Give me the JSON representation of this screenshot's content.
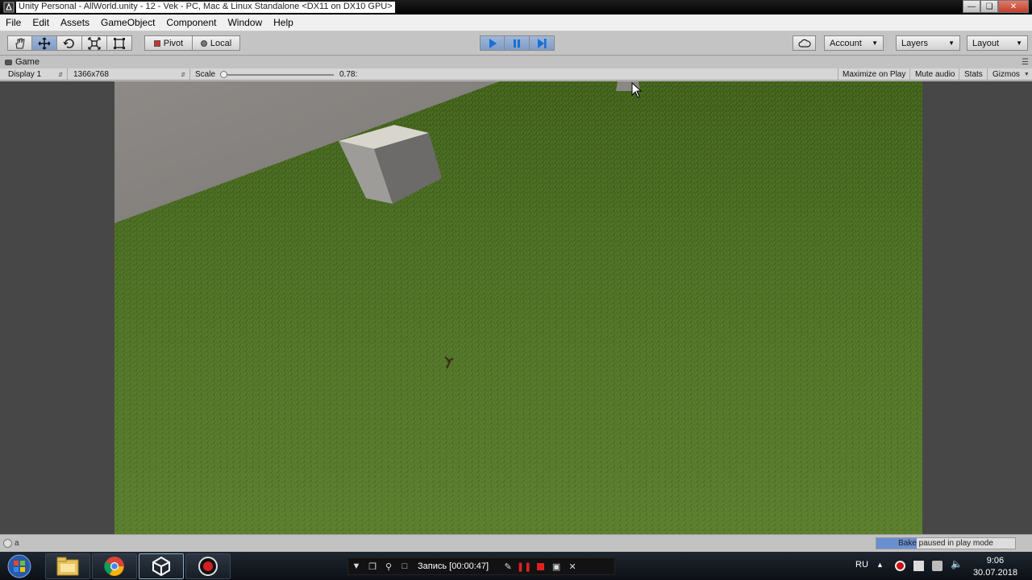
{
  "window": {
    "title": "Unity Personal - AllWorld.unity - 12 - Vek - PC, Mac & Linux Standalone <DX11 on DX10 GPU>",
    "buttons": [
      "minimize",
      "maximize",
      "close"
    ]
  },
  "menu": [
    "File",
    "Edit",
    "Assets",
    "GameObject",
    "Component",
    "Window",
    "Help"
  ],
  "toolbar": {
    "transform_tools": [
      "hand-icon",
      "move-icon",
      "rotate-icon",
      "scale-icon",
      "rect-icon"
    ],
    "pivot_label": "Pivot",
    "local_label": "Local",
    "playback": [
      "play-icon",
      "pause-icon",
      "step-icon"
    ],
    "account_label": "Account",
    "layers_label": "Layers",
    "layout_label": "Layout"
  },
  "game_tab": {
    "label": "Game"
  },
  "game_controls": {
    "display": "Display 1",
    "resolution": "1366x768",
    "scale_label": "Scale",
    "scale_value": "0.78:",
    "scale_fraction": 0.0,
    "maximize_on_play": "Maximize on Play",
    "mute_audio": "Mute audio",
    "stats": "Stats",
    "gizmos": "Gizmos"
  },
  "status": {
    "message": "a",
    "bake_text": "Bake paused in play mode",
    "bake_progress": 0.29
  },
  "taskbar": {
    "apps": [
      "file-explorer-icon",
      "chrome-icon",
      "unity-icon",
      "recorder-icon"
    ],
    "recorder_text": "Запись [00:00:47]",
    "language": "RU",
    "time": "9:06",
    "date": "30.07.2018"
  },
  "colors": {
    "accent_play": "#7f9cc6",
    "grass": "#4a6a22",
    "road": "#8c8884",
    "bake_fill": "#6a8fd0"
  }
}
